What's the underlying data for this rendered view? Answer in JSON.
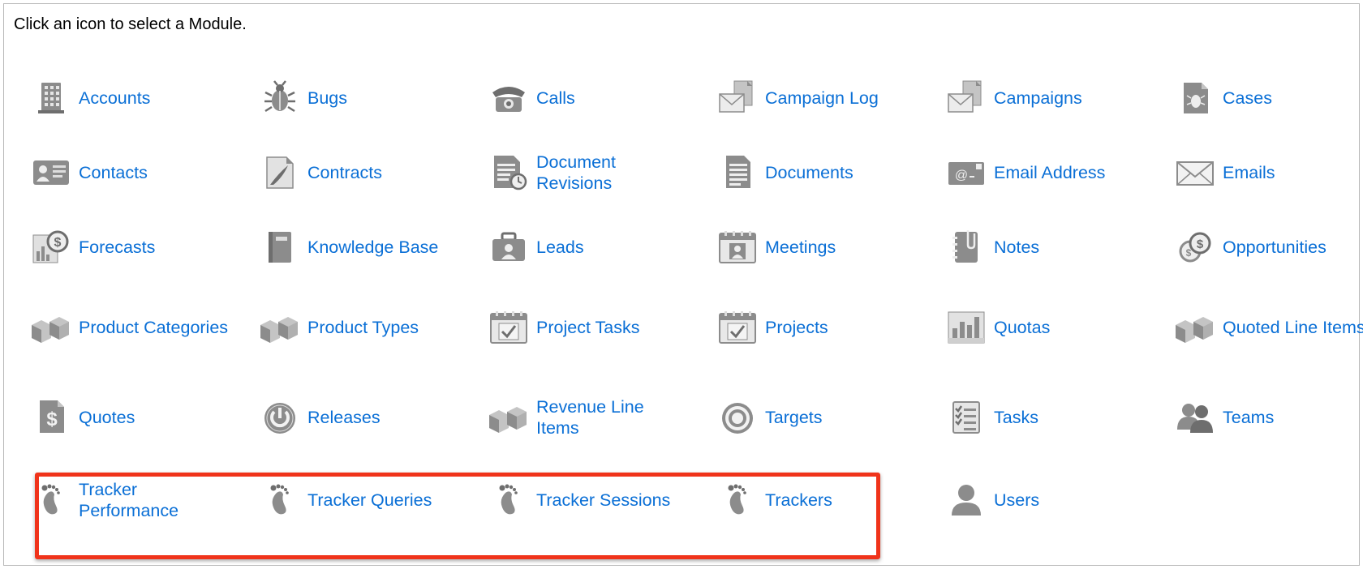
{
  "instruction": "Click an icon to select a Module.",
  "modules": [
    {
      "label": "Accounts",
      "icon": "building-icon"
    },
    {
      "label": "Bugs",
      "icon": "bug-icon"
    },
    {
      "label": "Calls",
      "icon": "telephone-icon"
    },
    {
      "label": "Campaign Log",
      "icon": "campaign-envelope-icon"
    },
    {
      "label": "Campaigns",
      "icon": "campaign-envelope-icon"
    },
    {
      "label": "Cases",
      "icon": "case-document-icon"
    },
    {
      "label": "Contacts",
      "icon": "contact-card-icon"
    },
    {
      "label": "Contracts",
      "icon": "contract-pen-icon"
    },
    {
      "label": "Document Revisions",
      "icon": "document-revision-icon"
    },
    {
      "label": "Documents",
      "icon": "document-icon"
    },
    {
      "label": "Email Address",
      "icon": "email-address-icon"
    },
    {
      "label": "Emails",
      "icon": "envelope-icon"
    },
    {
      "label": "Forecasts",
      "icon": "forecast-chart-icon"
    },
    {
      "label": "Knowledge Base",
      "icon": "book-icon"
    },
    {
      "label": "Leads",
      "icon": "briefcase-icon"
    },
    {
      "label": "Meetings",
      "icon": "meeting-calendar-icon"
    },
    {
      "label": "Notes",
      "icon": "notebook-clip-icon"
    },
    {
      "label": "Opportunities",
      "icon": "coins-icon"
    },
    {
      "label": "Product Categories",
      "icon": "boxes-icon"
    },
    {
      "label": "Product Types",
      "icon": "boxes-icon"
    },
    {
      "label": "Project Tasks",
      "icon": "calendar-check-icon"
    },
    {
      "label": "Projects",
      "icon": "calendar-check-icon"
    },
    {
      "label": "Quotas",
      "icon": "bar-chart-icon"
    },
    {
      "label": "Quoted Line Items",
      "icon": "boxes-icon"
    },
    {
      "label": "Quotes",
      "icon": "dollar-document-icon"
    },
    {
      "label": "Releases",
      "icon": "power-icon"
    },
    {
      "label": "Revenue Line Items",
      "icon": "boxes-icon"
    },
    {
      "label": "Targets",
      "icon": "target-icon"
    },
    {
      "label": "Tasks",
      "icon": "checklist-icon"
    },
    {
      "label": "Teams",
      "icon": "team-icon"
    },
    {
      "label": "Tracker Performance",
      "icon": "footprint-icon"
    },
    {
      "label": "Tracker Queries",
      "icon": "footprint-icon"
    },
    {
      "label": "Tracker Sessions",
      "icon": "footprint-icon"
    },
    {
      "label": "Trackers",
      "icon": "footprint-icon"
    },
    {
      "label": "Users",
      "icon": "user-icon"
    }
  ],
  "colors": {
    "link": "#0a6fd6",
    "icon": "#8c8c8c",
    "highlight": "#f0331a",
    "border": "#b8b8b8"
  }
}
